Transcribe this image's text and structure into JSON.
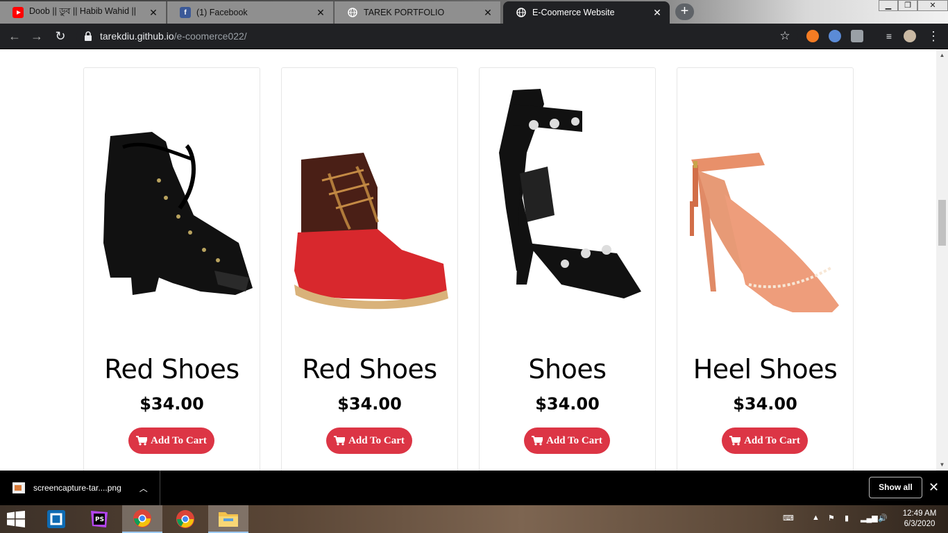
{
  "browser": {
    "tabs": [
      {
        "title": "Doob || ডুব || Habib Wahid ||",
        "icon": "youtube-icon",
        "active": false
      },
      {
        "title": "(1) Facebook",
        "icon": "facebook-icon",
        "active": false
      },
      {
        "title": "TAREK PORTFOLIO",
        "icon": "globe-icon",
        "active": false
      },
      {
        "title": "E-Coomerce Website",
        "icon": "globe-icon",
        "active": true
      }
    ],
    "url_host": "tarekdiu.github.io",
    "url_path": "/e-coomerce022/"
  },
  "products": [
    {
      "name": "Red Shoes",
      "price": "$34.00",
      "button": "Add To Cart",
      "image": "black-velvet-lace-up-bootie"
    },
    {
      "name": "Red Shoes",
      "price": "$34.00",
      "button": "Add To Cart",
      "image": "red-brown-duck-boot"
    },
    {
      "name": "Shoes",
      "price": "$34.00",
      "button": "Add To Cart",
      "image": "black-jeweled-strappy-heel"
    },
    {
      "name": "Heel Shoes",
      "price": "$34.00",
      "button": "Add To Cart",
      "image": "coral-ankle-strap-pump"
    }
  ],
  "downloads": {
    "file_name": "screencapture-tar....png",
    "show_all": "Show all"
  },
  "taskbar": {
    "time": "12:49 AM",
    "date": "6/3/2020"
  },
  "colors": {
    "accent_button": "#dc3545",
    "browser_dark": "#202124"
  }
}
